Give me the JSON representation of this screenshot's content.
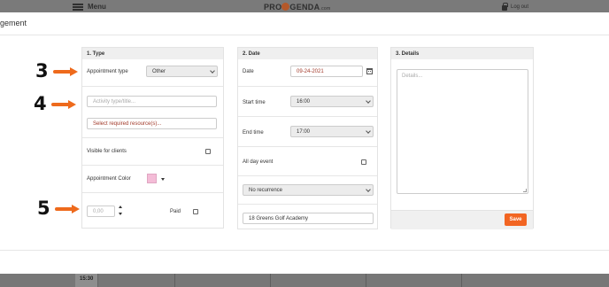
{
  "background": {
    "menu_label": "Menu",
    "logo_pre": "PRO",
    "logo_post": "GENDA",
    "logo_tld": ".com",
    "logout_label": "Log out",
    "time_slot": "15:30"
  },
  "modal": {
    "title": "gement"
  },
  "type_panel": {
    "title": "1. Type",
    "appointment_type_label": "Appointment type",
    "appointment_type_value": "Other",
    "activity_placeholder": "Activity type/title...",
    "resources_label": "Select required resource(s)...",
    "visible_label": "Visible for clients",
    "visible_checked": false,
    "color_label": "Appointment Color",
    "color_value": "#f4bcd7",
    "price_value": "0,00",
    "paid_label": "Paid",
    "paid_checked": false
  },
  "date_panel": {
    "title": "2. Date",
    "date_label": "Date",
    "date_value": "09-24-2021",
    "start_label": "Start time",
    "start_value": "16:00",
    "end_label": "End time",
    "end_value": "17:00",
    "all_day_label": "All day event",
    "all_day_checked": false,
    "recurrence_value": "No recurrence",
    "location_value": "18 Greens Golf Academy"
  },
  "details_panel": {
    "title": "3. Details",
    "details_placeholder": "Details...",
    "save_label": "Save"
  },
  "annotations": [
    "3",
    "4",
    "5"
  ],
  "colors": {
    "accent": "#f26522",
    "arrow": "#ee6a1c",
    "appointment_color": "#f4bcd7"
  }
}
